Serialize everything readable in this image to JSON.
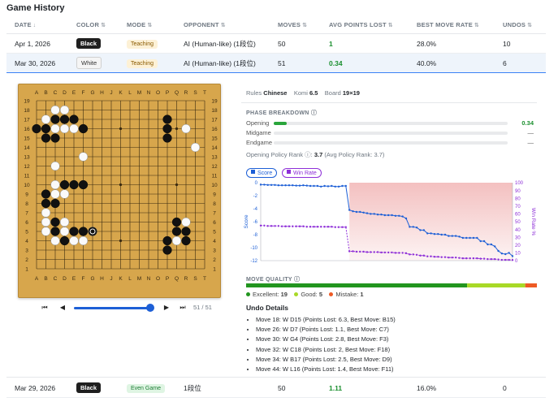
{
  "page_title": "Game History",
  "columns": [
    {
      "label": "DATE",
      "sort": "↓"
    },
    {
      "label": "COLOR",
      "sort": "⇅"
    },
    {
      "label": "MODE",
      "sort": "⇅"
    },
    {
      "label": "OPPONENT",
      "sort": "⇅"
    },
    {
      "label": "MOVES",
      "sort": "⇅"
    },
    {
      "label": "AVG POINTS LOST",
      "sort": "⇅"
    },
    {
      "label": "BEST MOVE RATE",
      "sort": "⇅"
    },
    {
      "label": "UNDOS",
      "sort": "⇅"
    }
  ],
  "rows": [
    {
      "date": "Apr 1, 2026",
      "color": "Black",
      "mode": "Teaching",
      "opponent": "AI (Human-like) (1段位)",
      "moves": "50",
      "avg_points_lost": "1",
      "best_move_rate": "28.0%",
      "undos": "10"
    },
    {
      "date": "Mar 30, 2026",
      "color": "White",
      "mode": "Teaching",
      "opponent": "AI (Human-like) (1段位)",
      "moves": "51",
      "avg_points_lost": "0.34",
      "best_move_rate": "40.0%",
      "undos": "6"
    },
    {
      "date": "Mar 29, 2026",
      "color": "Black",
      "mode": "Even Game",
      "opponent": "1段位",
      "moves": "50",
      "avg_points_lost": "1.11",
      "best_move_rate": "16.0%",
      "undos": "0"
    }
  ],
  "detail": {
    "rules_label": "Rules",
    "rules": "Chinese",
    "komi_label": "Komi",
    "komi": "6.5",
    "board_label": "Board",
    "board": "19×19",
    "phase_title": "PHASE BREAKDOWN",
    "phases": [
      {
        "label": "Opening",
        "value": "0.34",
        "fill": 0.055
      },
      {
        "label": "Midgame",
        "value": "—",
        "fill": 0
      },
      {
        "label": "Endgame",
        "value": "—",
        "fill": 0
      }
    ],
    "rank_label": "Opening Policy Rank",
    "rank_value": "3.7",
    "rank_avg": "(Avg Policy Rank: 3.7)",
    "legend_score": "Score",
    "legend_win": "Win Rate",
    "move_counter": "51 / 51",
    "board_cols": [
      "A",
      "B",
      "C",
      "D",
      "E",
      "F",
      "G",
      "H",
      "J",
      "K",
      "L",
      "M",
      "N",
      "O",
      "P",
      "Q",
      "R",
      "S",
      "T"
    ],
    "board_rows": [
      "19",
      "18",
      "17",
      "16",
      "15",
      "14",
      "13",
      "12",
      "11",
      "10",
      "9",
      "8",
      "7",
      "6",
      "5",
      "4",
      "3",
      "2",
      "1"
    ],
    "stones_black": [
      "C17",
      "D17",
      "E17",
      "A16",
      "B16",
      "F16",
      "B15",
      "C15",
      "P17",
      "P16",
      "P15",
      "E10",
      "B9",
      "D10",
      "F10",
      "B8",
      "C8",
      "C6",
      "E5",
      "C5",
      "F5",
      "D4",
      "Q6",
      "R5",
      "Q5",
      "P4",
      "R4",
      "P3"
    ],
    "stones_white": [
      "C18",
      "D18",
      "B17",
      "C16",
      "D16",
      "E16",
      "R16",
      "S14",
      "F13",
      "C12",
      "C10",
      "C9",
      "D9",
      "B7",
      "B6",
      "D6",
      "B5",
      "D5",
      "G5",
      "C4",
      "E4",
      "F4",
      "R6",
      "Q4"
    ],
    "last_move": "G5",
    "hoshi": [
      "D16",
      "K16",
      "Q16",
      "D10",
      "K10",
      "Q10",
      "D4",
      "K4",
      "Q4"
    ],
    "move_quality_title": "MOVE QUALITY",
    "quality": [
      {
        "label": "Excellent:",
        "count": 19,
        "color": "#22951f"
      },
      {
        "label": "Good:",
        "count": 5,
        "color": "#a8d927"
      },
      {
        "label": "Mistake:",
        "count": 1,
        "color": "#ee5a24"
      }
    ],
    "undo_title": "Undo Details",
    "undos": [
      "Move 18: W D15 (Points Lost: 6.3, Best Move: B15)",
      "Move 26: W D7 (Points Lost: 1.1, Best Move: C7)",
      "Move 30: W G4 (Points Lost: 2.8, Best Move: F3)",
      "Move 32: W C18 (Points Lost: 2, Best Move: F18)",
      "Move 34: W B17 (Points Lost: 2.5, Best Move: D9)",
      "Move 44: W L16 (Points Lost: 1.4, Best Move: F11)"
    ]
  },
  "chart_data": {
    "type": "line",
    "xlabel": "",
    "ylabel": "Score",
    "ylabel_right": "Win Rate %",
    "ylim": [
      -12,
      0
    ],
    "ylim_right": [
      0,
      100
    ],
    "yticks": [
      0,
      -2,
      -4,
      -6,
      -8,
      -10,
      -12
    ],
    "yticks_right": [
      100,
      90,
      80,
      70,
      60,
      50,
      40,
      30,
      20,
      10,
      0
    ],
    "series": [
      {
        "name": "Score",
        "color": "#1d5fd6",
        "axis": "left",
        "values": [
          -0.3,
          -0.3,
          -0.35,
          -0.35,
          -0.35,
          -0.4,
          -0.4,
          -0.4,
          -0.4,
          -0.4,
          -0.45,
          -0.45,
          -0.4,
          -0.45,
          -0.5,
          -0.5,
          -0.5,
          -0.6,
          -0.5,
          -0.55,
          -0.5,
          -0.6,
          -0.6,
          -0.5,
          -0.5,
          -4.2,
          -4.4,
          -4.5,
          -4.5,
          -4.6,
          -4.7,
          -4.8,
          -4.8,
          -4.9,
          -4.9,
          -5.0,
          -5.0,
          -5.0,
          -5.1,
          -5.1,
          -5.2,
          -5.5,
          -6.8,
          -6.8,
          -6.9,
          -7.3,
          -7.3,
          -7.8,
          -7.8,
          -7.9,
          -7.9,
          -8.0,
          -8.0,
          -8.2,
          -8.2,
          -8.2,
          -8.3,
          -8.5,
          -8.5,
          -8.5,
          -8.5,
          -8.5,
          -9.0,
          -9.0,
          -9.5,
          -9.5,
          -9.8,
          -10.5,
          -10.9,
          -11.0,
          -10.8,
          -11.3
        ]
      },
      {
        "name": "Win Rate",
        "color": "#8e2fd8",
        "axis": "right",
        "values": [
          45,
          45,
          44.5,
          44.5,
          44.5,
          44.5,
          44,
          44,
          44,
          44,
          44,
          44,
          44,
          43.5,
          43.5,
          43.5,
          43.5,
          43.5,
          43.5,
          43.5,
          43.5,
          43,
          43,
          43,
          43,
          12,
          12,
          11.5,
          11.5,
          11.5,
          11,
          11,
          11,
          11,
          10.5,
          10.5,
          10.5,
          10.5,
          10,
          10,
          10,
          9.5,
          8,
          8,
          7.5,
          6.5,
          6.5,
          5.5,
          5.5,
          5,
          5,
          4.5,
          4.5,
          4,
          4,
          4,
          3.5,
          3,
          3,
          3,
          3,
          3,
          2.5,
          2.5,
          2,
          2,
          2,
          1.5,
          1,
          1,
          1,
          0.8
        ]
      }
    ],
    "shaded_from_index": 25,
    "legend": "top-left"
  }
}
